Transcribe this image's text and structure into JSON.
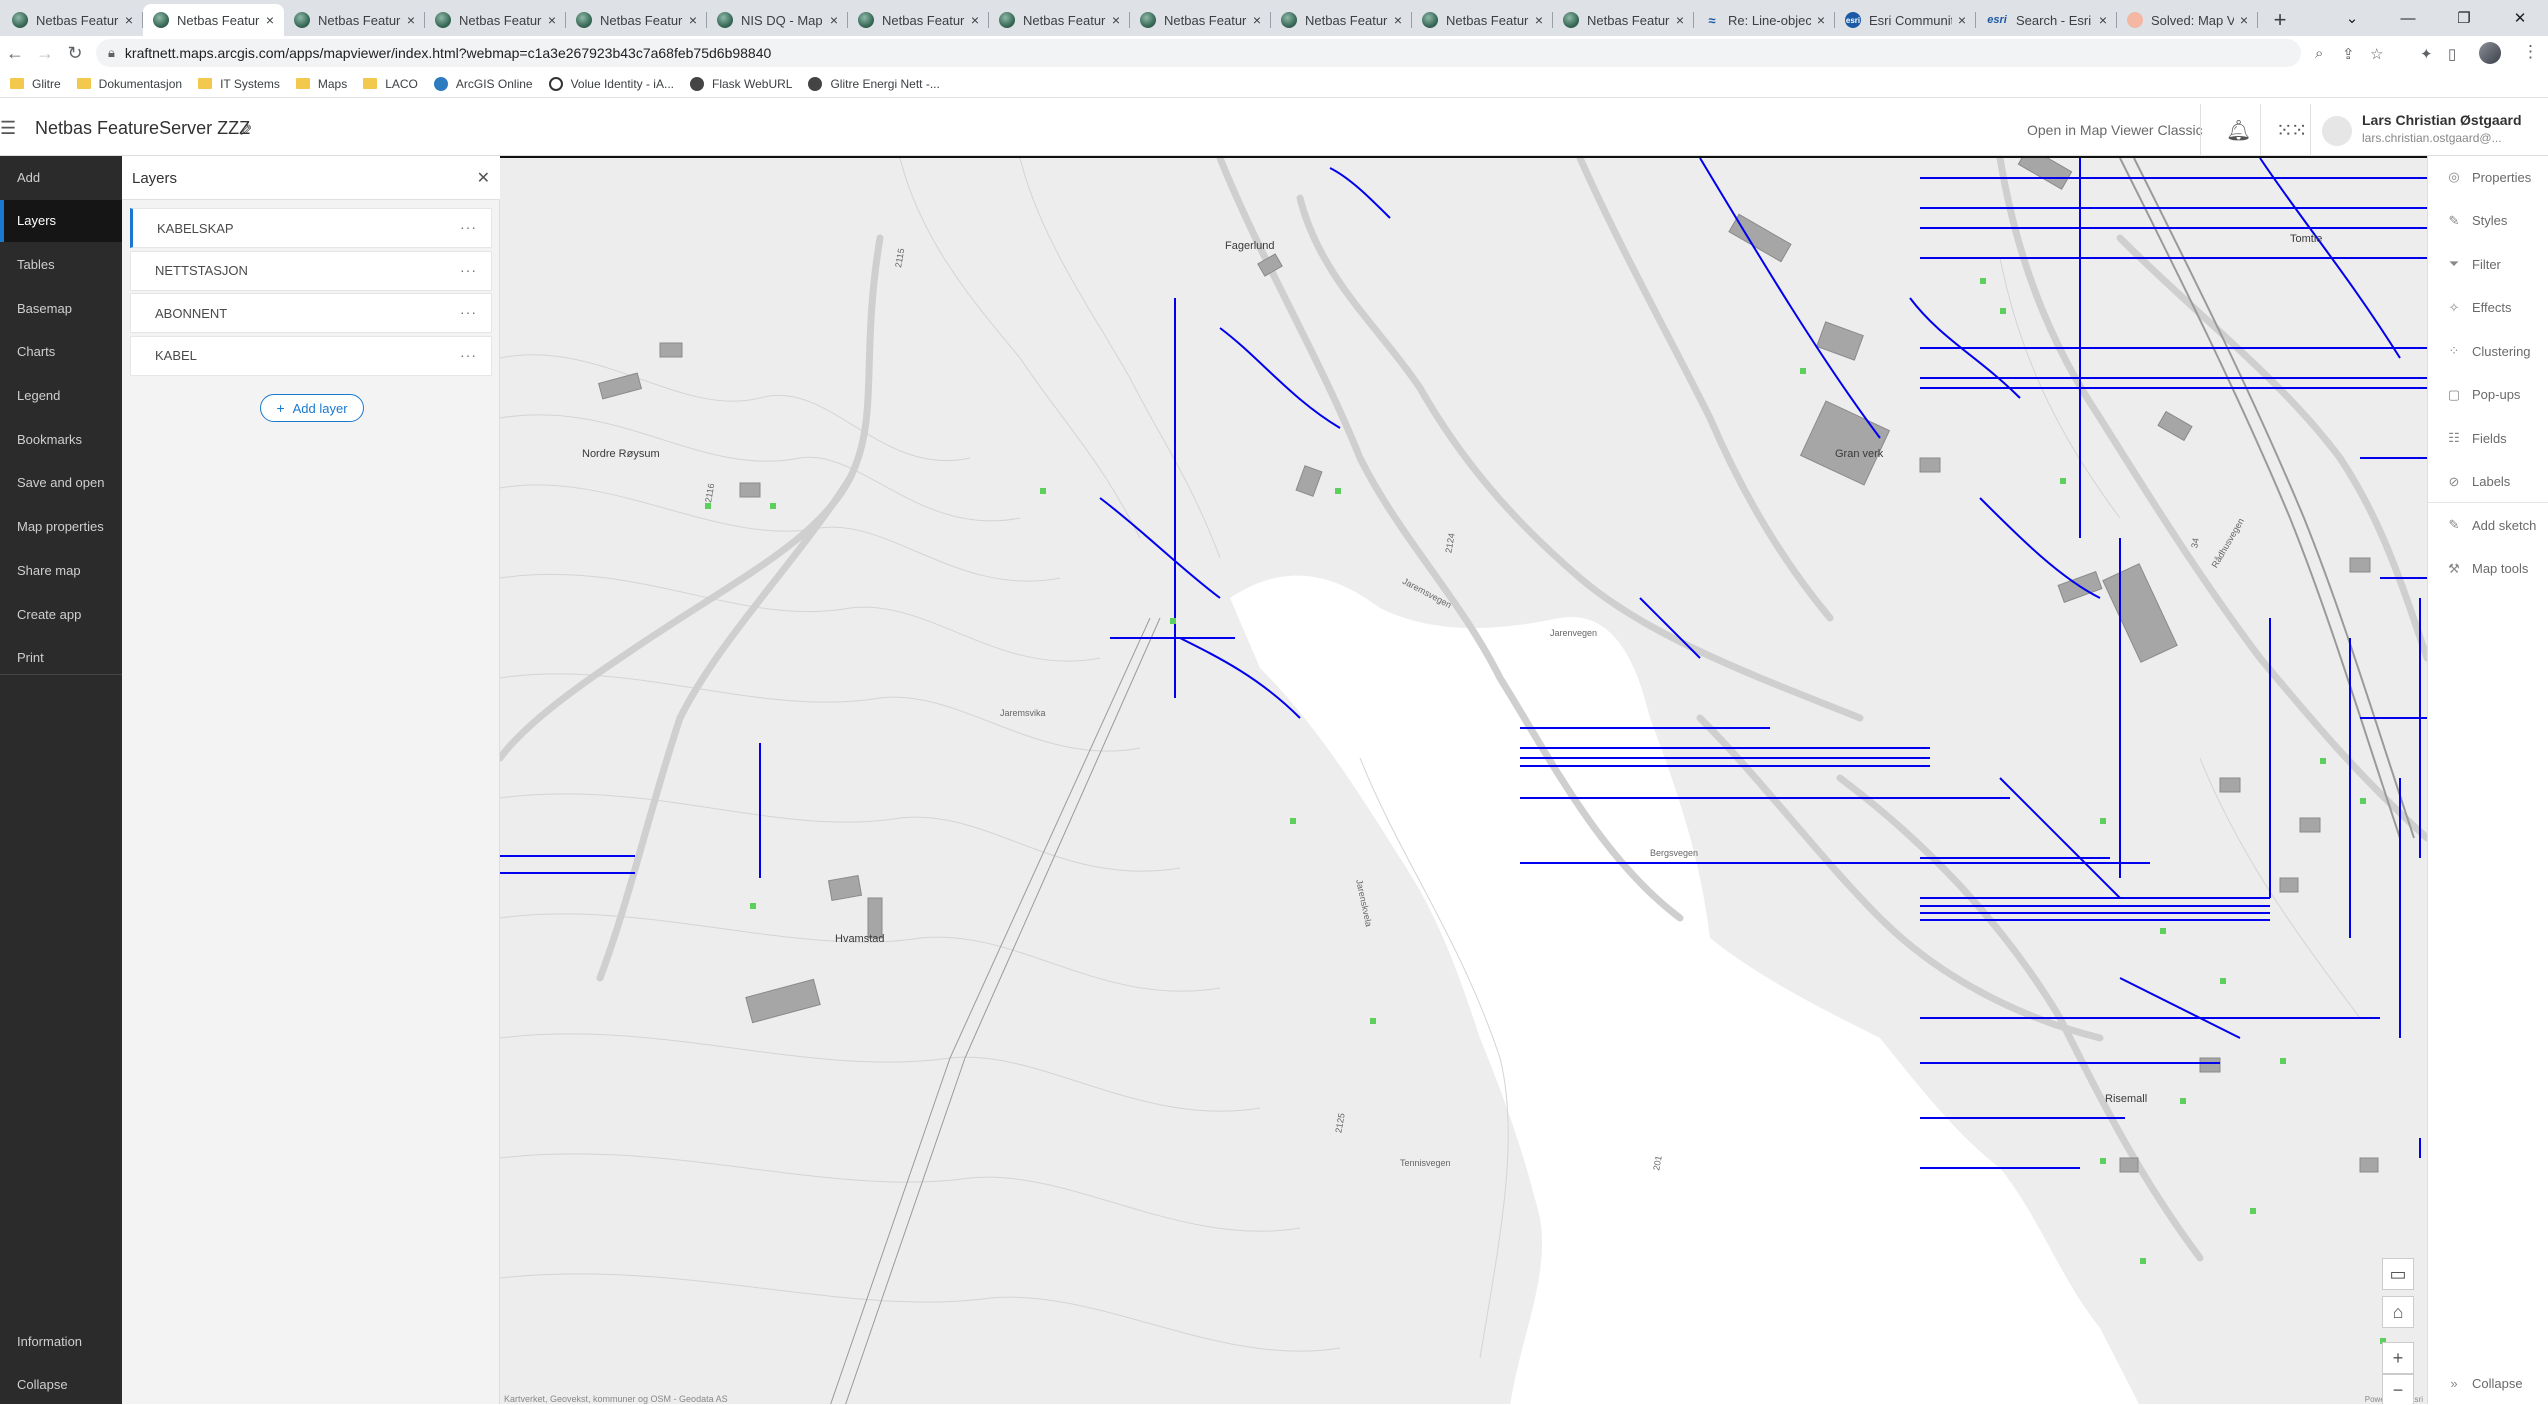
{
  "browser": {
    "tabs": [
      {
        "title": "Netbas Featur",
        "icon": "globe",
        "active": false
      },
      {
        "title": "Netbas Featur",
        "icon": "globe",
        "active": true
      },
      {
        "title": "Netbas Featur",
        "icon": "globe",
        "active": false
      },
      {
        "title": "Netbas Featur",
        "icon": "globe",
        "active": false
      },
      {
        "title": "Netbas Featur",
        "icon": "globe",
        "active": false
      },
      {
        "title": "NIS DQ - Map",
        "icon": "globe",
        "active": false
      },
      {
        "title": "Netbas Featur",
        "icon": "globe",
        "active": false
      },
      {
        "title": "Netbas Featur",
        "icon": "globe",
        "active": false
      },
      {
        "title": "Netbas Featur",
        "icon": "globe",
        "active": false
      },
      {
        "title": "Netbas Featur",
        "icon": "globe",
        "active": false
      },
      {
        "title": "Netbas Featur",
        "icon": "globe",
        "active": false
      },
      {
        "title": "Netbas Featur",
        "icon": "globe",
        "active": false
      },
      {
        "title": "Re: Line-object",
        "icon": "community",
        "active": false
      },
      {
        "title": "Esri Communit",
        "icon": "esri-c",
        "active": false
      },
      {
        "title": "Search - Esri C",
        "icon": "esri-t",
        "active": false
      },
      {
        "title": "Solved: Map V",
        "icon": "solved",
        "active": false
      }
    ],
    "tab_close_glyph": "×",
    "new_tab_glyph": "+",
    "url": "kraftnett.maps.arcgis.com/apps/mapviewer/index.html?webmap=c1a3e267923b43c7a68feb75d6b98840",
    "bookmarks": [
      {
        "label": "Glitre",
        "icon": "folder"
      },
      {
        "label": "Dokumentasjon",
        "icon": "folder"
      },
      {
        "label": "IT Systems",
        "icon": "folder"
      },
      {
        "label": "Maps",
        "icon": "folder"
      },
      {
        "label": "LACO",
        "icon": "folder"
      },
      {
        "label": "ArcGIS Online",
        "icon": "agol"
      },
      {
        "label": "Volue Identity - iA...",
        "icon": "circle"
      },
      {
        "label": "Flask WebURL",
        "icon": "globe"
      },
      {
        "label": "Glitre Energi Nett -...",
        "icon": "globe"
      }
    ]
  },
  "header": {
    "title": "Netbas FeatureServer ZZZ",
    "open_classic": "Open in Map Viewer Classic",
    "user_name": "Lars Christian Østgaard",
    "user_email": "lars.christian.ostgaard@..."
  },
  "left_toolbar": {
    "items": [
      "Add",
      "Layers",
      "Tables",
      "Basemap",
      "Charts",
      "Legend",
      "Bookmarks",
      "Save and open",
      "Map properties",
      "Share map",
      "Create app",
      "Print"
    ],
    "active": "Layers",
    "bottom": [
      "Information",
      "Collapse"
    ]
  },
  "layers_panel": {
    "title": "Layers",
    "layers": [
      "KABELSKAP",
      "NETTSTASJON",
      "ABONNENT",
      "KABEL"
    ],
    "selected": "KABELSKAP",
    "more_glyph": "···",
    "add_layer": "Add layer"
  },
  "right_toolbar": {
    "items": [
      "Properties",
      "Styles",
      "Filter",
      "Effects",
      "Clustering",
      "Pop-ups",
      "Fields",
      "Labels",
      "Add sketch",
      "Map tools"
    ],
    "bottom": "Collapse"
  },
  "map": {
    "places": [
      "Nordre Røysum",
      "Hvamstad",
      "Fagerlund",
      "Gran verk",
      "Tomtle",
      "Risemall",
      "Jaremsvegen",
      "Jarenvegen",
      "Jarenskvela",
      "Bergsvegen",
      "Tennisvegen",
      "Rådhusvegen",
      "Jaremsvika"
    ],
    "road_numbers": [
      "2115",
      "2116",
      "2124",
      "2125",
      "34",
      "201"
    ],
    "attribution": "Kartverket, Geovekst, kommuner og OSM - Geodata AS",
    "powered_by": "Powered by Esri",
    "line_color": "#0000ee",
    "point_color": "#5ccf5c"
  }
}
